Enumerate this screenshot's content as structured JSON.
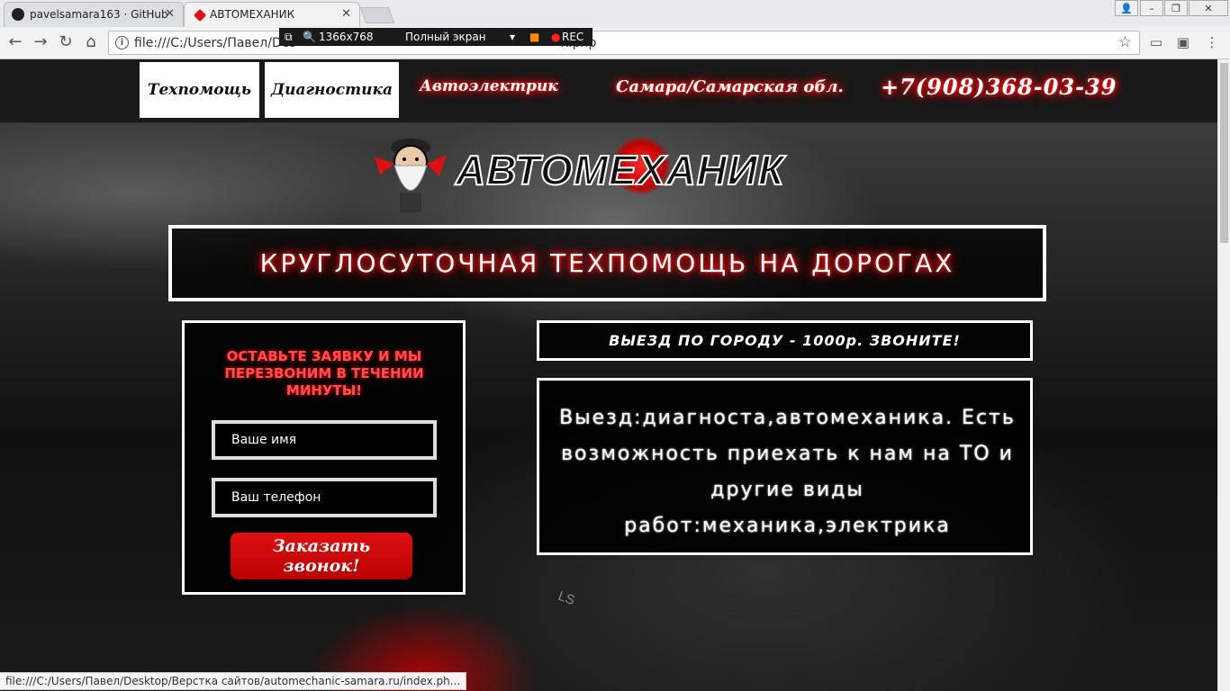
{
  "browser": {
    "tabs": [
      {
        "title": "pavelsamara163 · GitHub",
        "icon": "github-icon"
      },
      {
        "title": "АВТОМЕХАНИК",
        "icon": "site-favicon-icon"
      }
    ],
    "address": "file:///C:/Users/Павел/Desktop/Верстка сайтов/automechanic-samara.ru/index.php",
    "address_visible": "file:///C:/Users/Павел/Des",
    "address_tail": "x.php",
    "recorder": {
      "resolution": "1366x768",
      "mode": "Полный экран",
      "rec": "REC"
    },
    "status_url": "file:///C:/Users/Павел/Desktop/Верстка сайтов/automechanic-samara.ru/index.ph..."
  },
  "header": {
    "nav": [
      "Техпомощь",
      "Диагностика",
      "Автоэлектрик"
    ],
    "region": "Самара/Самарская обл.",
    "phone": "+7(908)368-03-39"
  },
  "logo": {
    "text": "АВТОМЕХАНИК"
  },
  "banner": {
    "text": "КРУГЛОСУТОЧНАЯ ТЕХПОМОЩЬ НА ДОРОГАХ"
  },
  "form": {
    "title": "ОСТАВЬТЕ ЗАЯВКУ И МЫ ПЕРЕЗВОНИМ В ТЕЧЕНИИ МИНУТЫ!",
    "name_placeholder": "Ваше имя",
    "phone_placeholder": "Ваш телефон",
    "submit_label": "Заказать звонок!"
  },
  "visit": {
    "text": "ВЫЕЗД ПО ГОРОДУ - 1000р. ЗВОНИТЕ!"
  },
  "services": {
    "text": "Выезд:диагноста,автомеханика. Есть возможность приехать к нам на ТО и другие виды работ:механика,электрика"
  },
  "decor": {
    "badge": "LS"
  },
  "colors": {
    "accent": "#ff0000",
    "header_bg": "#191919",
    "button": "#d00000"
  }
}
